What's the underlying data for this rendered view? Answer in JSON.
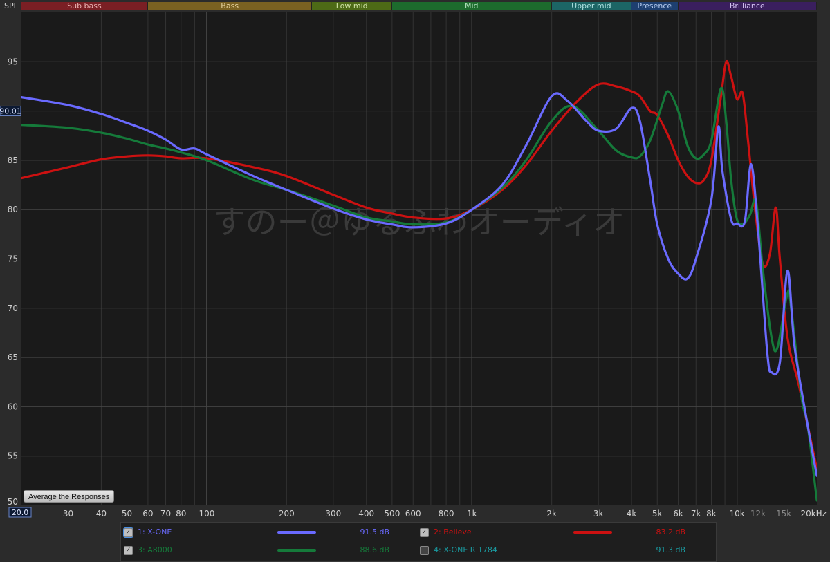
{
  "spl_label": "SPL",
  "bands": [
    {
      "label": "Sub bass",
      "from": 20,
      "to": 60,
      "bg": "#7a1f24",
      "fg": "#e8b0b0"
    },
    {
      "label": "Bass",
      "from": 60,
      "to": 250,
      "bg": "#7a6121",
      "fg": "#e6d3a0"
    },
    {
      "label": "Low mid",
      "from": 250,
      "to": 500,
      "bg": "#4d6a16",
      "fg": "#cfe2a5"
    },
    {
      "label": "Mid",
      "from": 500,
      "to": 2000,
      "bg": "#1d6b2d",
      "fg": "#b5e2bf"
    },
    {
      "label": "Upper mid",
      "from": 2000,
      "to": 4000,
      "bg": "#1c6565",
      "fg": "#aee0e0"
    },
    {
      "label": "Presence",
      "from": 4000,
      "to": 6000,
      "bg": "#1d3f70",
      "fg": "#b7cdf0"
    },
    {
      "label": "Brilliance",
      "from": 6000,
      "to": 20000,
      "bg": "#3a1f5e",
      "fg": "#d1bff0"
    }
  ],
  "cursor_value": "90.01",
  "cursor_freq": "20.0",
  "watermark": "すのー＠ゆるふわオーディオ",
  "average_button": "Average the Responses",
  "colors": {
    "plot_bg": "#1a1a1a",
    "grid_major": "#555555",
    "grid_minor": "#333333",
    "axis_text": "#cfcfcf"
  },
  "chart_data": {
    "type": "line",
    "xscale": "log",
    "xlim": [
      20,
      20000
    ],
    "ylim": [
      50,
      100
    ],
    "x_ticks": [
      {
        "v": 30,
        "t": "30"
      },
      {
        "v": 40,
        "t": "40"
      },
      {
        "v": 50,
        "t": "50"
      },
      {
        "v": 60,
        "t": "60"
      },
      {
        "v": 70,
        "t": "70"
      },
      {
        "v": 80,
        "t": "80"
      },
      {
        "v": 100,
        "t": "100"
      },
      {
        "v": 200,
        "t": "200"
      },
      {
        "v": 300,
        "t": "300"
      },
      {
        "v": 400,
        "t": "400"
      },
      {
        "v": 500,
        "t": "500"
      },
      {
        "v": 600,
        "t": "600"
      },
      {
        "v": 800,
        "t": "800"
      },
      {
        "v": 1000,
        "t": "1k"
      },
      {
        "v": 2000,
        "t": "2k"
      },
      {
        "v": 3000,
        "t": "3k"
      },
      {
        "v": 4000,
        "t": "4k"
      },
      {
        "v": 5000,
        "t": "5k"
      },
      {
        "v": 6000,
        "t": "6k"
      },
      {
        "v": 7000,
        "t": "7k"
      },
      {
        "v": 8000,
        "t": "8k"
      },
      {
        "v": 10000,
        "t": "10k"
      },
      {
        "v": 12000,
        "t": "12k"
      },
      {
        "v": 15000,
        "t": "15k"
      },
      {
        "v": 20000,
        "t": "20kHz"
      }
    ],
    "y_ticks": [
      55,
      60,
      65,
      70,
      75,
      80,
      85,
      90,
      95
    ],
    "series": [
      {
        "name": "X-ONE",
        "color": "#6a6aff",
        "points": [
          [
            20,
            91.4
          ],
          [
            30,
            90.6
          ],
          [
            40,
            89.7
          ],
          [
            50,
            88.8
          ],
          [
            60,
            88.0
          ],
          [
            70,
            87.1
          ],
          [
            80,
            86.1
          ],
          [
            90,
            86.2
          ],
          [
            100,
            85.6
          ],
          [
            150,
            83.4
          ],
          [
            200,
            82.0
          ],
          [
            300,
            80.1
          ],
          [
            400,
            79.0
          ],
          [
            500,
            78.5
          ],
          [
            600,
            78.2
          ],
          [
            800,
            78.6
          ],
          [
            1000,
            80.0
          ],
          [
            1300,
            82.5
          ],
          [
            1600,
            86.5
          ],
          [
            2000,
            91.5
          ],
          [
            2300,
            91.0
          ],
          [
            2700,
            89.0
          ],
          [
            3000,
            88.0
          ],
          [
            3500,
            88.2
          ],
          [
            4000,
            90.3
          ],
          [
            4300,
            89.0
          ],
          [
            4700,
            83.0
          ],
          [
            5000,
            78.5
          ],
          [
            5500,
            75.0
          ],
          [
            6000,
            73.5
          ],
          [
            6500,
            73.0
          ],
          [
            7000,
            75.0
          ],
          [
            8000,
            81.0
          ],
          [
            8500,
            88.4
          ],
          [
            8800,
            84.0
          ],
          [
            9500,
            79.0
          ],
          [
            10000,
            78.6
          ],
          [
            10700,
            78.8
          ],
          [
            11300,
            84.6
          ],
          [
            12000,
            78.0
          ],
          [
            13000,
            65.5
          ],
          [
            13500,
            63.5
          ],
          [
            14500,
            64.5
          ],
          [
            15500,
            73.8
          ],
          [
            16500,
            66.0
          ],
          [
            18500,
            58.0
          ],
          [
            20000,
            53.0
          ]
        ]
      },
      {
        "name": "Believe",
        "color": "#cc1111",
        "points": [
          [
            20,
            83.2
          ],
          [
            30,
            84.3
          ],
          [
            40,
            85.1
          ],
          [
            50,
            85.4
          ],
          [
            60,
            85.5
          ],
          [
            70,
            85.4
          ],
          [
            80,
            85.2
          ],
          [
            100,
            85.2
          ],
          [
            150,
            84.3
          ],
          [
            200,
            83.4
          ],
          [
            300,
            81.5
          ],
          [
            400,
            80.2
          ],
          [
            500,
            79.6
          ],
          [
            600,
            79.2
          ],
          [
            800,
            79.1
          ],
          [
            1000,
            80.0
          ],
          [
            1300,
            82.0
          ],
          [
            1600,
            84.5
          ],
          [
            2000,
            88.0
          ],
          [
            2500,
            91.0
          ],
          [
            3000,
            92.7
          ],
          [
            3500,
            92.5
          ],
          [
            4000,
            92.0
          ],
          [
            4300,
            91.5
          ],
          [
            4700,
            90.0
          ],
          [
            5000,
            89.6
          ],
          [
            5500,
            87.5
          ],
          [
            6000,
            85.0
          ],
          [
            6500,
            83.4
          ],
          [
            7000,
            82.7
          ],
          [
            7500,
            83.0
          ],
          [
            8000,
            85.0
          ],
          [
            8700,
            91.5
          ],
          [
            9100,
            95.0
          ],
          [
            9500,
            93.5
          ],
          [
            10000,
            91.2
          ],
          [
            10500,
            91.8
          ],
          [
            11000,
            87.0
          ],
          [
            11700,
            80.0
          ],
          [
            12500,
            74.5
          ],
          [
            13300,
            75.5
          ],
          [
            14000,
            80.2
          ],
          [
            14500,
            75.0
          ],
          [
            15500,
            67.0
          ],
          [
            17000,
            62.5
          ],
          [
            18500,
            58.0
          ],
          [
            20000,
            53.7
          ]
        ]
      },
      {
        "name": "A8000",
        "color": "#157a3a",
        "points": [
          [
            20,
            88.6
          ],
          [
            30,
            88.3
          ],
          [
            40,
            87.8
          ],
          [
            50,
            87.2
          ],
          [
            60,
            86.6
          ],
          [
            70,
            86.2
          ],
          [
            80,
            85.8
          ],
          [
            100,
            85.0
          ],
          [
            150,
            83.0
          ],
          [
            200,
            82.0
          ],
          [
            300,
            80.4
          ],
          [
            400,
            79.2
          ],
          [
            500,
            78.8
          ],
          [
            600,
            78.5
          ],
          [
            800,
            78.7
          ],
          [
            1000,
            80.0
          ],
          [
            1300,
            82.2
          ],
          [
            1600,
            85.0
          ],
          [
            2000,
            89.0
          ],
          [
            2400,
            90.5
          ],
          [
            3000,
            88.0
          ],
          [
            3500,
            86.0
          ],
          [
            4000,
            85.3
          ],
          [
            4300,
            85.4
          ],
          [
            4700,
            87.0
          ],
          [
            5200,
            90.5
          ],
          [
            5500,
            92.0
          ],
          [
            6000,
            90.0
          ],
          [
            6500,
            86.5
          ],
          [
            7000,
            85.2
          ],
          [
            7500,
            85.6
          ],
          [
            8000,
            87.0
          ],
          [
            8700,
            92.3
          ],
          [
            9100,
            89.0
          ],
          [
            9500,
            83.0
          ],
          [
            10000,
            79.0
          ],
          [
            10600,
            78.6
          ],
          [
            11200,
            79.5
          ],
          [
            11800,
            80.8
          ],
          [
            12500,
            74.0
          ],
          [
            13500,
            67.0
          ],
          [
            14200,
            66.0
          ],
          [
            15500,
            71.5
          ],
          [
            16000,
            70.0
          ],
          [
            17500,
            61.0
          ],
          [
            18500,
            58.0
          ],
          [
            20000,
            50.5
          ]
        ]
      }
    ]
  },
  "legend": [
    {
      "index": "1: X-ONE",
      "color": "#6a6aff",
      "db": "91.5 dB",
      "checked": true,
      "selected": true,
      "col": 0,
      "row": 0,
      "show_swatch": true
    },
    {
      "index": "2: Believe",
      "color": "#cc1111",
      "db": "83.2 dB",
      "checked": true,
      "selected": false,
      "col": 1,
      "row": 0,
      "show_swatch": true
    },
    {
      "index": "3: A8000",
      "color": "#157a3a",
      "db": "88.6 dB",
      "checked": true,
      "selected": false,
      "col": 0,
      "row": 1,
      "show_swatch": true
    },
    {
      "index": "4: X-ONE R 1784",
      "color": "#1a9aa0",
      "db": "91.3 dB",
      "checked": false,
      "selected": false,
      "col": 1,
      "row": 1,
      "show_swatch": false
    }
  ]
}
